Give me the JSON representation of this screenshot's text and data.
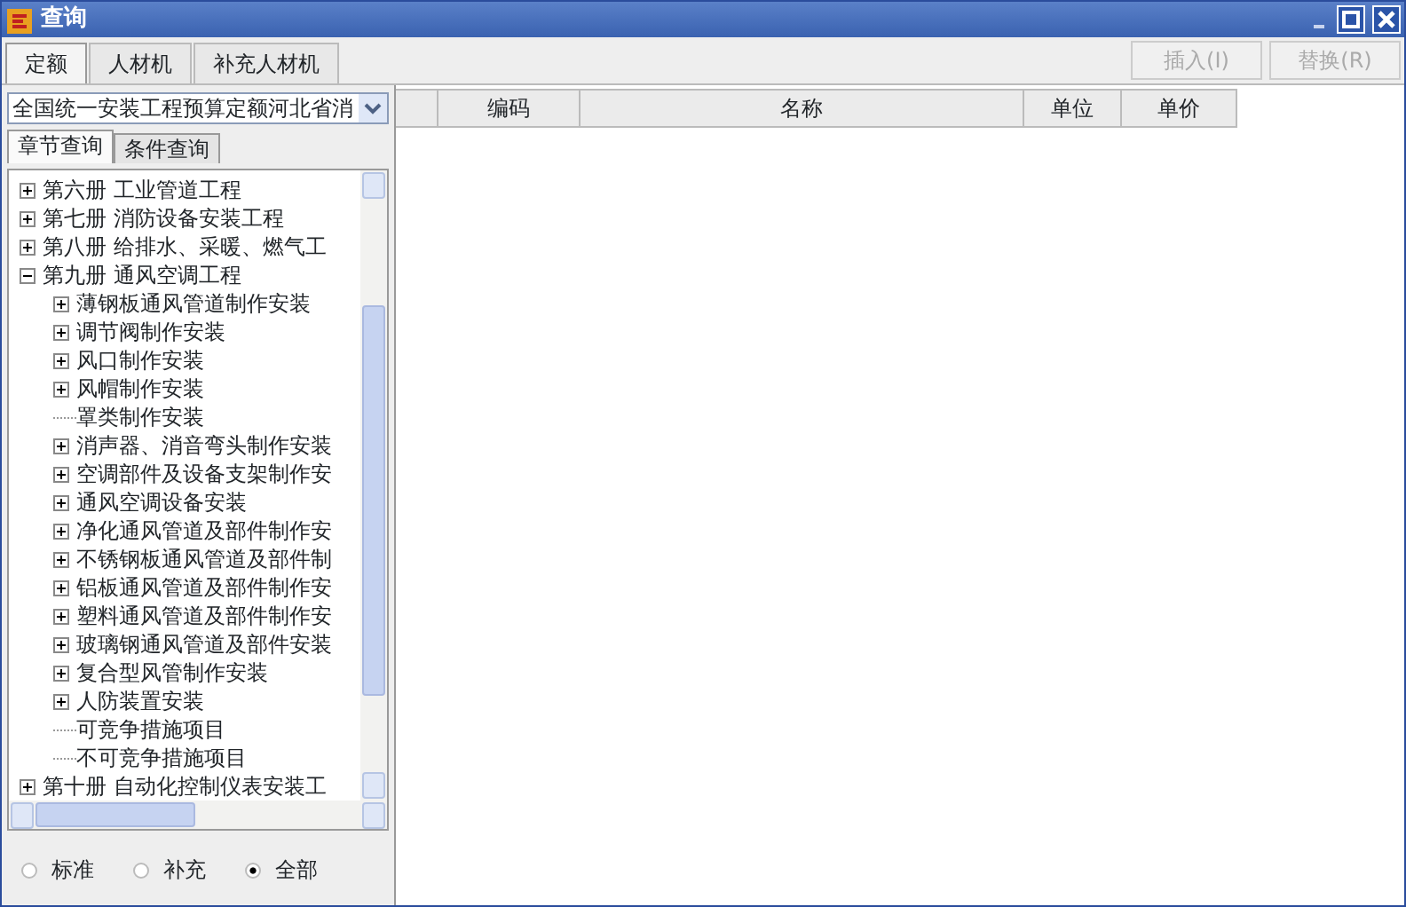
{
  "window": {
    "title": "查询"
  },
  "tabs": [
    {
      "label": "定额",
      "selected": true
    },
    {
      "label": "人材机",
      "selected": false
    },
    {
      "label": "补充人材机",
      "selected": false
    }
  ],
  "buttons": [
    {
      "label": "插入(I)",
      "disabled": true
    },
    {
      "label": "替换(R)",
      "disabled": true
    }
  ],
  "library": {
    "value": "全国统一安装工程预算定额河北省消"
  },
  "sub_tabs": [
    {
      "label": "章节查询",
      "selected": true
    },
    {
      "label": "条件查询",
      "selected": false
    }
  ],
  "tree": [
    {
      "label": "第六册  工业管道工程",
      "expanded": false
    },
    {
      "label": "第七册  消防设备安装工程",
      "expanded": false
    },
    {
      "label": "第八册  给排水、采暖、燃气工",
      "expanded": false
    },
    {
      "label": "第九册  通风空调工程",
      "expanded": true,
      "children": [
        {
          "label": "薄钢板通风管道制作安装",
          "expanded": false
        },
        {
          "label": "调节阀制作安装",
          "expanded": false
        },
        {
          "label": "风口制作安装",
          "expanded": false
        },
        {
          "label": "风帽制作安装",
          "expanded": false
        },
        {
          "label": "罩类制作安装"
        },
        {
          "label": "消声器、消音弯头制作安装",
          "expanded": false
        },
        {
          "label": "空调部件及设备支架制作安",
          "expanded": false
        },
        {
          "label": "通风空调设备安装",
          "expanded": false
        },
        {
          "label": "净化通风管道及部件制作安",
          "expanded": false
        },
        {
          "label": "不锈钢板通风管道及部件制",
          "expanded": false
        },
        {
          "label": "铝板通风管道及部件制作安",
          "expanded": false
        },
        {
          "label": "塑料通风管道及部件制作安",
          "expanded": false
        },
        {
          "label": "玻璃钢通风管道及部件安装",
          "expanded": false
        },
        {
          "label": "复合型风管制作安装",
          "expanded": false
        },
        {
          "label": "人防装置安装",
          "expanded": false
        },
        {
          "label": "可竞争措施项目"
        },
        {
          "label": "不可竞争措施项目"
        }
      ]
    },
    {
      "label": "第十册  自动化控制仪表安装工",
      "expanded": false
    }
  ],
  "filter": [
    {
      "label": "标准",
      "selected": false
    },
    {
      "label": "补充",
      "selected": false
    },
    {
      "label": "全部",
      "selected": true
    }
  ],
  "table": {
    "columns": [
      "编码",
      "名称",
      "单位",
      "单价"
    ]
  }
}
